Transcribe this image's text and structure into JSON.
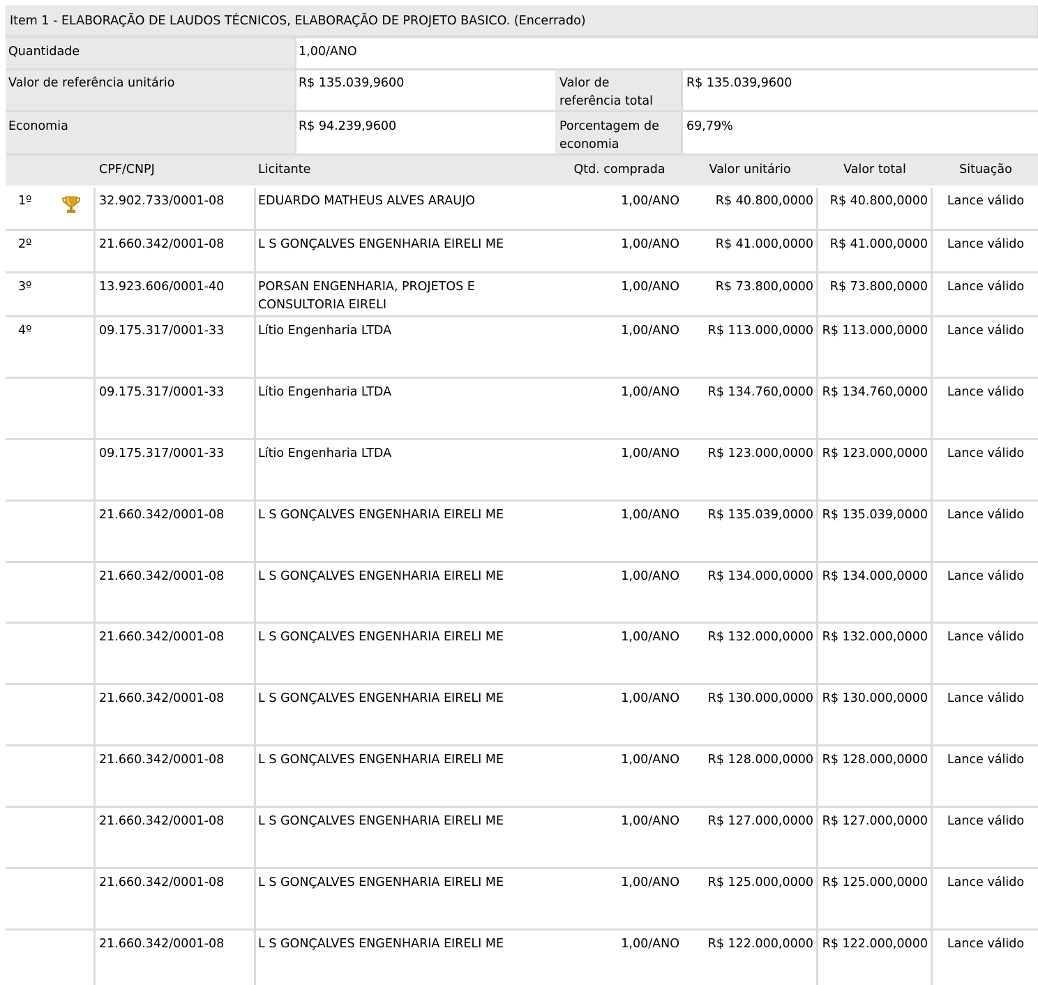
{
  "item_title": "Item 1 - ELABORAÇÃO DE LAUDOS TÉCNICOS, ELABORAÇÃO DE PROJETO BASICO. (Encerrado)",
  "summary": {
    "quantidade_label": "Quantidade",
    "quantidade_value": "1,00/ANO",
    "ref_unit_label": "Valor de referência unitário",
    "ref_unit_value": "R$ 135.039,9600",
    "ref_total_label": "Valor de referência total",
    "ref_total_value": "R$ 135.039,9600",
    "economia_label": "Economia",
    "economia_value": "R$ 94.239,9600",
    "pct_label": "Porcentagem de economia",
    "pct_value": "69,79%"
  },
  "columns": {
    "cpf": "CPF/CNPJ",
    "licitante": "Licitante",
    "qtd": "Qtd. comprada",
    "unit": "Valor unitário",
    "total": "Valor total",
    "sit": "Situação"
  },
  "trophy_icon": "trophy-icon",
  "rows": [
    {
      "rank": "1º",
      "cpf": "32.902.733/0001-08",
      "licitante": "EDUARDO MATHEUS ALVES ARAUJO",
      "qtd": "1,00/ANO",
      "unit": "R$ 40.800,0000",
      "total": "R$ 40.800,0000",
      "sit": "Lance válido"
    },
    {
      "rank": "2º",
      "cpf": "21.660.342/0001-08",
      "licitante": "L S GONÇALVES ENGENHARIA EIRELI ME",
      "qtd": "1,00/ANO",
      "unit": "R$ 41.000,0000",
      "total": "R$ 41.000,0000",
      "sit": "Lance válido"
    },
    {
      "rank": "3º",
      "cpf": "13.923.606/0001-40",
      "licitante": "PORSAN ENGENHARIA, PROJETOS E CONSULTORIA EIRELI",
      "qtd": "1,00/ANO",
      "unit": "R$ 73.800,0000",
      "total": "R$ 73.800,0000",
      "sit": "Lance válido"
    },
    {
      "rank": "4º",
      "cpf": "09.175.317/0001-33",
      "licitante": "Lítio Engenharia LTDA",
      "qtd": "1,00/ANO",
      "unit": "R$ 113.000,0000",
      "total": "R$ 113.000,0000",
      "sit": "Lance válido"
    },
    {
      "rank": "",
      "cpf": "09.175.317/0001-33",
      "licitante": "Lítio Engenharia LTDA",
      "qtd": "1,00/ANO",
      "unit": "R$ 134.760,0000",
      "total": "R$ 134.760,0000",
      "sit": "Lance válido"
    },
    {
      "rank": "",
      "cpf": "09.175.317/0001-33",
      "licitante": "Lítio Engenharia LTDA",
      "qtd": "1,00/ANO",
      "unit": "R$ 123.000,0000",
      "total": "R$ 123.000,0000",
      "sit": "Lance válido"
    },
    {
      "rank": "",
      "cpf": "21.660.342/0001-08",
      "licitante": "L S GONÇALVES ENGENHARIA EIRELI ME",
      "qtd": "1,00/ANO",
      "unit": "R$ 135.039,0000",
      "total": "R$ 135.039,0000",
      "sit": "Lance válido"
    },
    {
      "rank": "",
      "cpf": "21.660.342/0001-08",
      "licitante": "L S GONÇALVES ENGENHARIA EIRELI ME",
      "qtd": "1,00/ANO",
      "unit": "R$ 134.000,0000",
      "total": "R$ 134.000,0000",
      "sit": "Lance válido"
    },
    {
      "rank": "",
      "cpf": "21.660.342/0001-08",
      "licitante": "L S GONÇALVES ENGENHARIA EIRELI ME",
      "qtd": "1,00/ANO",
      "unit": "R$ 132.000,0000",
      "total": "R$ 132.000,0000",
      "sit": "Lance válido"
    },
    {
      "rank": "",
      "cpf": "21.660.342/0001-08",
      "licitante": "L S GONÇALVES ENGENHARIA EIRELI ME",
      "qtd": "1,00/ANO",
      "unit": "R$ 130.000,0000",
      "total": "R$ 130.000,0000",
      "sit": "Lance válido"
    },
    {
      "rank": "",
      "cpf": "21.660.342/0001-08",
      "licitante": "L S GONÇALVES ENGENHARIA EIRELI ME",
      "qtd": "1,00/ANO",
      "unit": "R$ 128.000,0000",
      "total": "R$ 128.000,0000",
      "sit": "Lance válido"
    },
    {
      "rank": "",
      "cpf": "21.660.342/0001-08",
      "licitante": "L S GONÇALVES ENGENHARIA EIRELI ME",
      "qtd": "1,00/ANO",
      "unit": "R$ 127.000,0000",
      "total": "R$ 127.000,0000",
      "sit": "Lance válido"
    },
    {
      "rank": "",
      "cpf": "21.660.342/0001-08",
      "licitante": "L S GONÇALVES ENGENHARIA EIRELI ME",
      "qtd": "1,00/ANO",
      "unit": "R$ 125.000,0000",
      "total": "R$ 125.000,0000",
      "sit": "Lance válido"
    },
    {
      "rank": "",
      "cpf": "21.660.342/0001-08",
      "licitante": "L S GONÇALVES ENGENHARIA EIRELI ME",
      "qtd": "1,00/ANO",
      "unit": "R$ 122.000,0000",
      "total": "R$ 122.000,0000",
      "sit": "Lance válido"
    }
  ]
}
